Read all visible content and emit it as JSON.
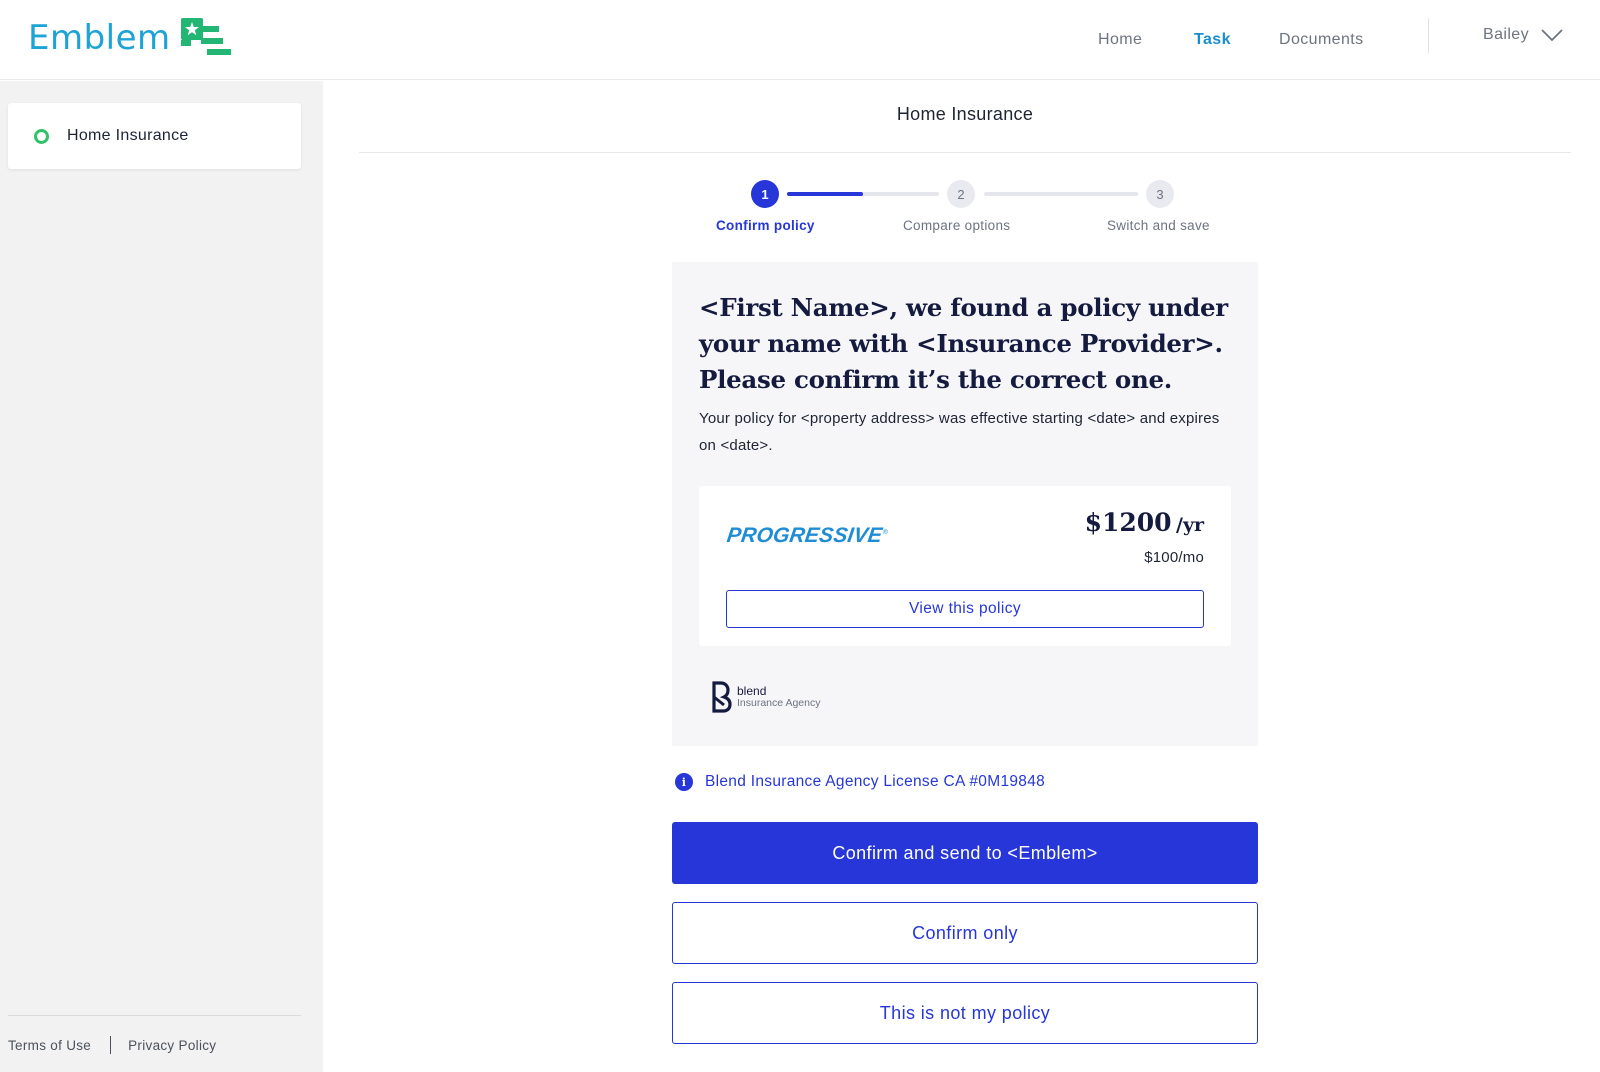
{
  "header": {
    "brand": "Emblem",
    "nav": {
      "home": "Home",
      "task": "Task",
      "documents": "Documents"
    },
    "user_name": "Bailey",
    "accent_color": "#1a8fd0"
  },
  "sidebar": {
    "items": [
      {
        "label": "Home Insurance",
        "status_color": "#33c26b"
      }
    ],
    "footer": {
      "terms": "Terms of Use",
      "privacy": "Privacy Policy"
    }
  },
  "main": {
    "title": "Home Insurance",
    "stepper": {
      "current_step": 1,
      "progress_to_step_2": 0.5,
      "steps": [
        {
          "number": "1",
          "label": "Confirm policy"
        },
        {
          "number": "2",
          "label": "Compare options"
        },
        {
          "number": "3",
          "label": "Switch and save"
        }
      ]
    },
    "policy": {
      "headline": "<First Name>, we found a policy under your name with <Insurance Provider>. Please confirm it’s the correct one.",
      "description": "Your policy for <property address> was effective starting <date> and expires on <date>.",
      "provider_logo": "PROGRESSIVE",
      "price_annual": "$1200",
      "price_annual_unit": "/yr",
      "price_monthly": "$100/mo",
      "view_button": "View this policy",
      "agency_name": "blend",
      "agency_sub": "Insurance Agency"
    },
    "license_text": "Blend Insurance Agency License CA #0M19848",
    "actions": {
      "primary": "Confirm and send to <Emblem>",
      "secondary": "Confirm only",
      "tertiary": "This is not my policy"
    },
    "primary_color": "#2636d8"
  }
}
